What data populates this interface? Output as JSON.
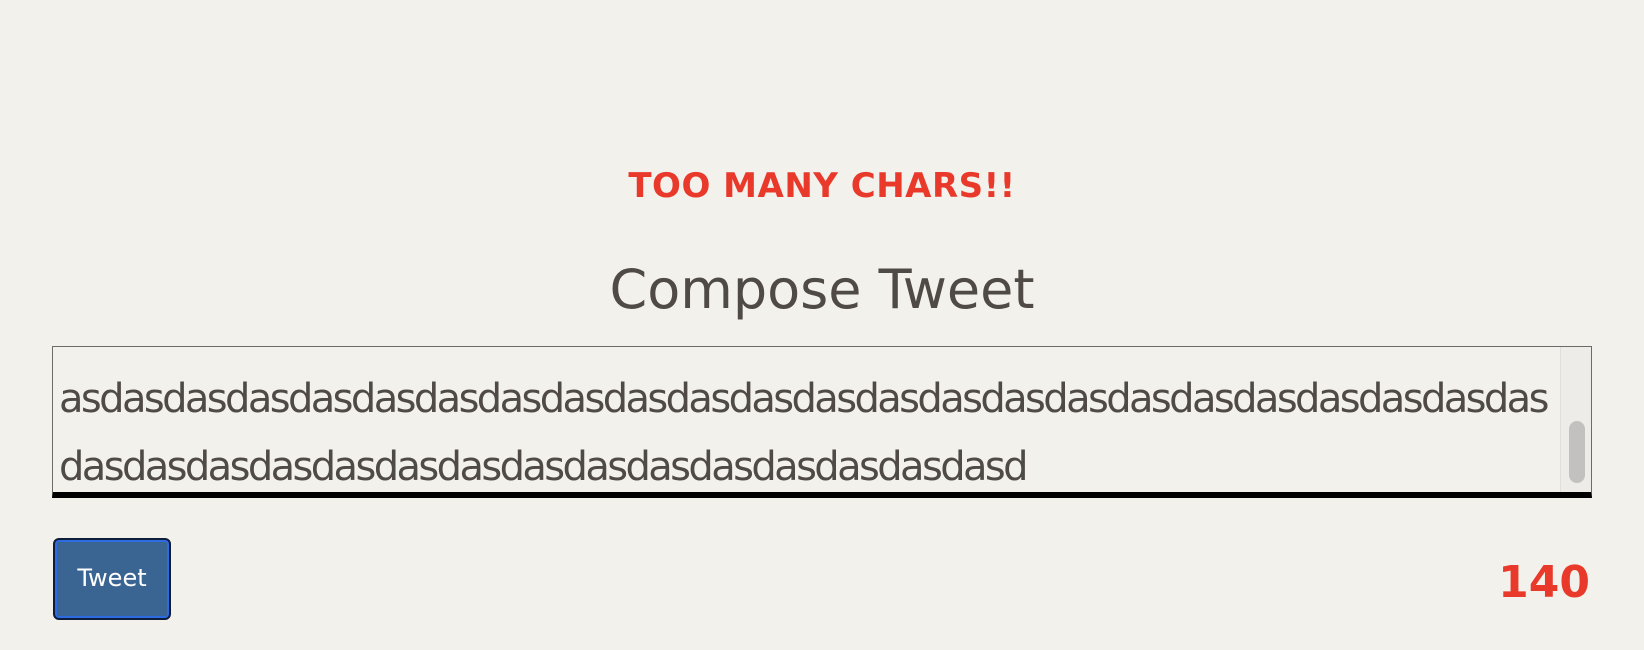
{
  "warning": {
    "text": "TOO MANY CHARS!!",
    "color": "#e8392b"
  },
  "compose": {
    "title": "Compose Tweet"
  },
  "tweet_input": {
    "value": "asdasdasdasdasdasdasdasdasdasdasdasdasdasdasdasdasdasdasdasdasdasdasdasdasdasdasdasdasdasdasdasdasdasdasdasdasdasdasd"
  },
  "actions": {
    "tweet_label": "Tweet",
    "button_color": "#3a6491"
  },
  "counter": {
    "value": "140",
    "color": "#e8392b"
  }
}
